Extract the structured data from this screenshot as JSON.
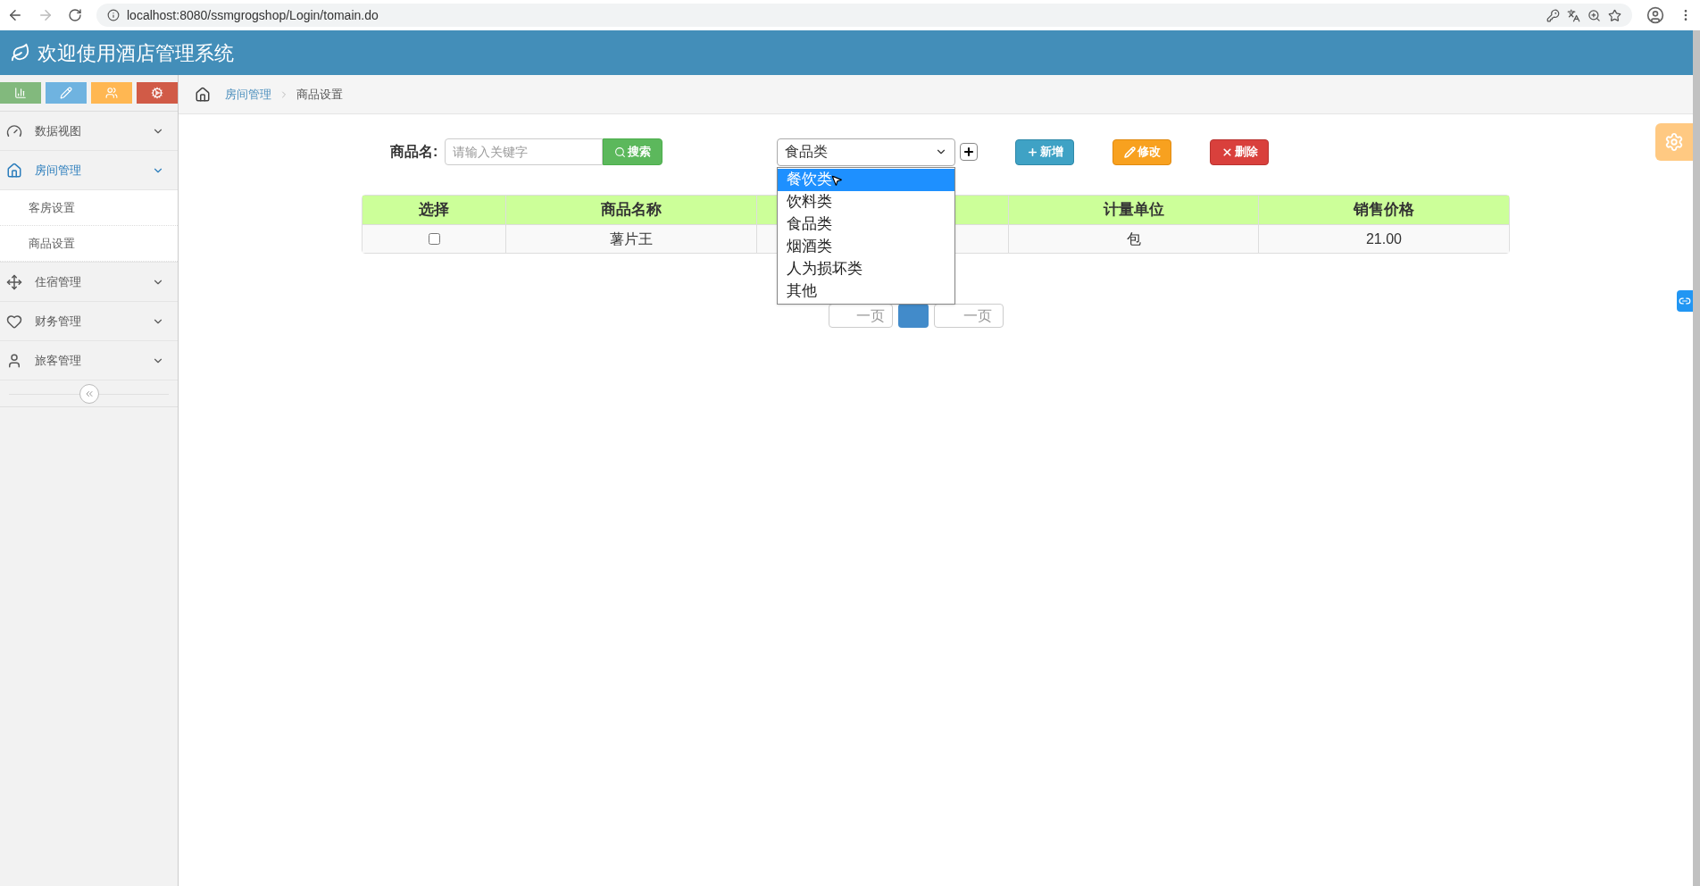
{
  "browser": {
    "url": "localhost:8080/ssmgrogshop/Login/tomain.do"
  },
  "app": {
    "title": "欢迎使用酒店管理系统"
  },
  "shortcuts": [
    {
      "color": "#82b97d"
    },
    {
      "color": "#6fb3e0"
    },
    {
      "color": "#ffb752"
    },
    {
      "color": "#d15b47"
    }
  ],
  "sidebar": {
    "items": [
      {
        "label": "数据视图",
        "selected": false
      },
      {
        "label": "房间管理",
        "selected": true,
        "children": [
          {
            "label": "客房设置"
          },
          {
            "label": "商品设置"
          }
        ]
      },
      {
        "label": "住宿管理",
        "selected": false
      },
      {
        "label": "财务管理",
        "selected": false
      },
      {
        "label": "旅客管理",
        "selected": false
      }
    ]
  },
  "breadcrumb": [
    {
      "label": "房间管理",
      "link": true
    },
    {
      "label": "商品设置",
      "link": false
    }
  ],
  "search": {
    "label": "商品名:",
    "placeholder": "请输入关键字",
    "button": "搜索"
  },
  "category_select": {
    "value": "食品类",
    "open": true,
    "options": [
      {
        "label": "餐饮类",
        "highlighted": true
      },
      {
        "label": "饮料类",
        "highlighted": false
      },
      {
        "label": "食品类",
        "highlighted": false
      },
      {
        "label": "烟酒类",
        "highlighted": false
      },
      {
        "label": "人为损坏类",
        "highlighted": false
      },
      {
        "label": "其他",
        "highlighted": false
      }
    ]
  },
  "actions": [
    {
      "kind": "add",
      "label": "新增"
    },
    {
      "kind": "edit",
      "label": "修改"
    },
    {
      "kind": "delete",
      "label": "删除"
    }
  ],
  "table": {
    "columns": [
      {
        "label": "选择"
      },
      {
        "label": "商品名称"
      },
      {},
      {
        "label": "计量单位"
      },
      {
        "label": "销售价格"
      }
    ],
    "rows": [
      {
        "checked": false,
        "cells": [
          "",
          "薯片王",
          "",
          "包",
          "21.00"
        ]
      }
    ]
  },
  "pagination": {
    "prev": "一页",
    "pages": [
      {
        "selected": true
      }
    ],
    "next": "一页"
  }
}
